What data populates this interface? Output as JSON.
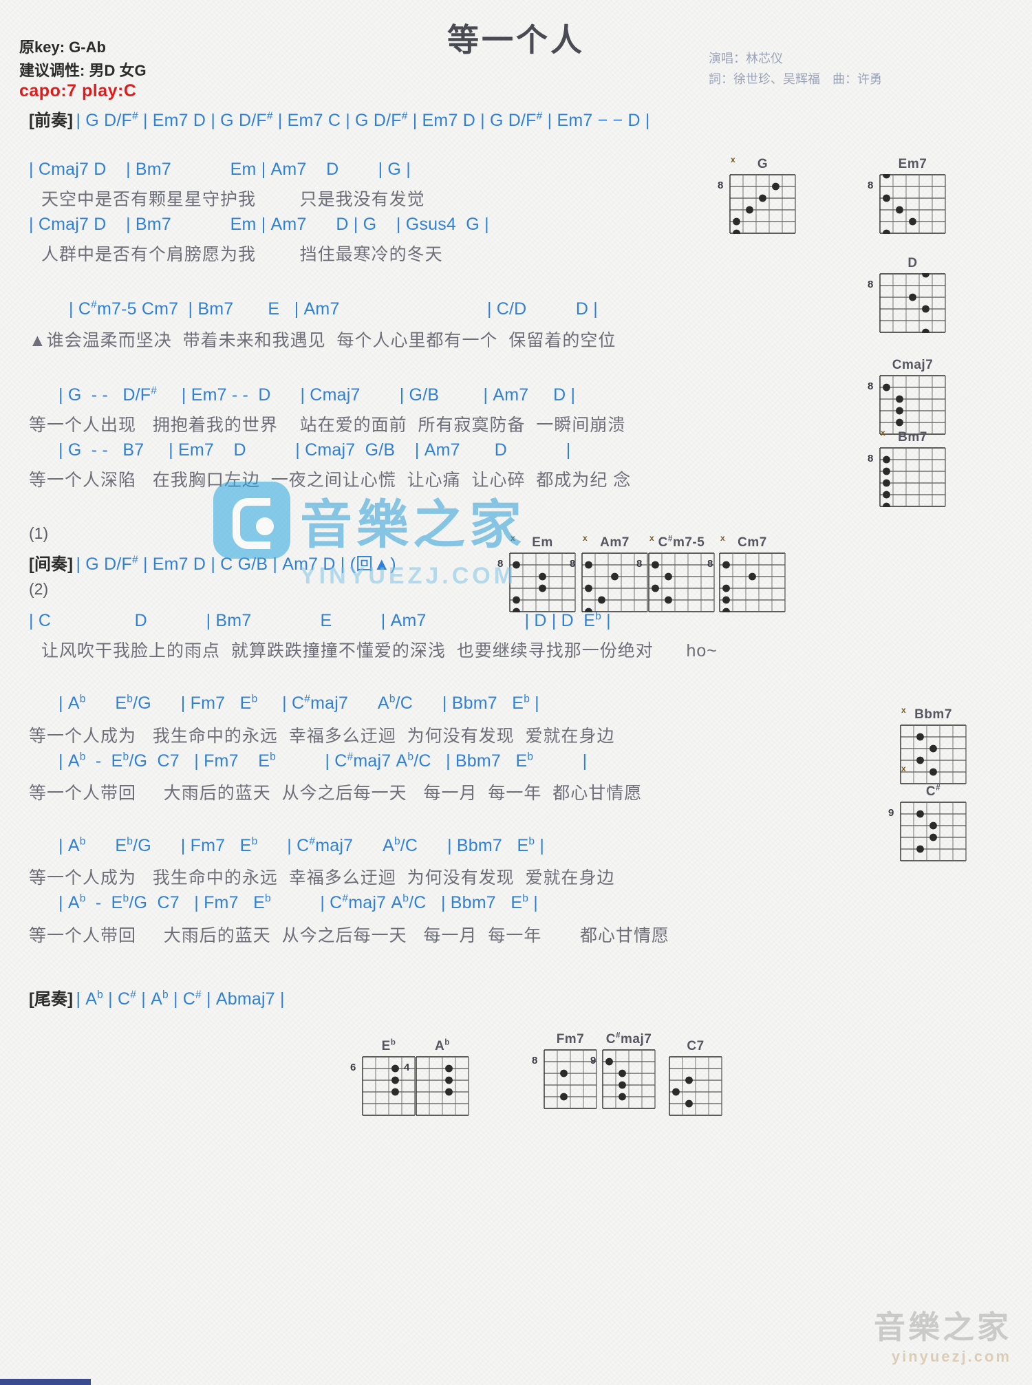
{
  "header": {
    "orig_key_label": "原key: G-Ab",
    "suggested_key_label": "建议调性: 男D 女G",
    "title": "等一个人",
    "singer": "演唱：林芯仪",
    "writers": "詞：徐世珍、吴辉福　曲：许勇",
    "capo": "capo:7 play:C"
  },
  "colors": {
    "chord": "#2f80d8",
    "lyric": "#6e6e78",
    "capo": "#e01b1b",
    "bar": "#b87820",
    "title": "#4a4a52",
    "watermark_blue": "#2f9fd9"
  },
  "sections": {
    "intro_label": "[前奏]",
    "interlude_label": "[间奏]",
    "outro_label": "[尾奏]",
    "ending_one": "(1)",
    "ending_two": "(2)",
    "repeat_mark": "▲"
  },
  "lines": [
    {
      "id": "intro",
      "type": "chords",
      "label": "[前奏]",
      "text": "| G D/F# | Em7 D | G D/F# | Em7 C | G D/F# | Em7 D | G D/F# | Em7 − − D |"
    },
    {
      "id": "v1c1",
      "type": "chords",
      "text": "| Cmaj7 D    | Bm7            Em | Am7    D        | G |"
    },
    {
      "id": "v1l1",
      "type": "lyric",
      "text": "天空中是否有颗星星守护我        只是我没有发觉"
    },
    {
      "id": "v1c2",
      "type": "chords",
      "text": "| Cmaj7 D    | Bm7            Em | Am7      D | G    | Gsus4  G |"
    },
    {
      "id": "v1l2",
      "type": "lyric",
      "text": "人群中是否有个肩膀愿为我        挡住最寒冷的冬天"
    },
    {
      "id": "prec1",
      "type": "chords",
      "text": "| C#m7-5 Cm7  | Bm7       E   | Am7                              | C/D          D |"
    },
    {
      "id": "prel1",
      "type": "lyric",
      "text": "▲谁会温柔而坚决  带着未来和我遇见  每个人心里都有一个  保留着的空位"
    },
    {
      "id": "ch1c1",
      "type": "chords",
      "text": "| G  - -   D/F#     | Em7 - -  D      | Cmaj7        | G/B         | Am7     D |"
    },
    {
      "id": "ch1l1",
      "type": "lyric",
      "text": "等一个人出现   拥抱着我的世界    站在爱的面前  所有寂寞防备  一瞬间崩溃"
    },
    {
      "id": "ch1c2",
      "type": "chords",
      "text": "| G  - -   B7     | Em7    D          | Cmaj7  G/B    | Am7       D            |"
    },
    {
      "id": "ch1l2",
      "type": "lyric",
      "text": "等一个人深陷   在我胸口左边  一夜之间让心慌  让心痛  让心碎  都成为纪 念"
    },
    {
      "id": "inter",
      "type": "chords",
      "label": "[间奏]",
      "text": "| G D/F# | Em7 D | C G/B | Am7 D | (回▲)"
    },
    {
      "id": "v2c1",
      "type": "chords",
      "text": "| C                 D            | Bm7              E          | Am7                    | D | D  Eb |"
    },
    {
      "id": "v2l1",
      "type": "lyric",
      "text": "让风吹干我脸上的雨点  就算跌跌撞撞不懂爱的深浅  也要继续寻找那一份绝对      ho~"
    },
    {
      "id": "ch2c1",
      "type": "chords",
      "text": "| Ab      Eb/G      | Fm7   Eb     | C#maj7      Ab/C      | Bbm7   Eb |"
    },
    {
      "id": "ch2l1",
      "type": "lyric",
      "text": "等一个人成为   我生命中的永远  幸福多么迂迴  为何没有发现  爱就在身边"
    },
    {
      "id": "ch2c2",
      "type": "chords",
      "text": "| Ab  -  Eb/G  C7   | Fm7    Eb          | C#maj7 Ab/C   | Bbm7   Eb          |"
    },
    {
      "id": "ch2l2",
      "type": "lyric",
      "text": "等一个人带回     大雨后的蓝天  从今之后每一天   每一月  每一年  都心甘情愿"
    },
    {
      "id": "ch3c1",
      "type": "chords",
      "text": "| Ab      Eb/G      | Fm7   Eb      | C#maj7      Ab/C      | Bbm7   Eb |"
    },
    {
      "id": "ch3l1",
      "type": "lyric",
      "text": "等一个人成为   我生命中的永远  幸福多么迂迴  为何没有发现  爱就在身边"
    },
    {
      "id": "ch3c2",
      "type": "chords",
      "text": "| Ab  -  Eb/G  C7   | Fm7   Eb          | C#maj7 Ab/C   | Bbm7   Eb |"
    },
    {
      "id": "ch3l2",
      "type": "lyric",
      "text": "等一个人带回     大雨后的蓝天  从今之后每一天   每一月  每一年       都心甘情愿"
    },
    {
      "id": "outro",
      "type": "chords",
      "label": "[尾奏]",
      "text": "| Ab | C# | Ab | C# | Abmaj7 |"
    }
  ],
  "chord_diagrams": [
    {
      "name": "G",
      "fret": "8",
      "strings": 6,
      "frets": 5,
      "mutes": [
        {
          "s": 0,
          "m": "x"
        }
      ],
      "dots": [
        {
          "s": 1,
          "f": 4
        },
        {
          "s": 2,
          "f": 3
        },
        {
          "s": 3,
          "f": 2
        },
        {
          "s": 4,
          "f": 1
        },
        {
          "s": 5,
          "f": 1
        }
      ]
    },
    {
      "name": "Em7",
      "fret": "8",
      "strings": 6,
      "frets": 5,
      "mutes": [],
      "dots": [
        {
          "s": 0,
          "f": 1
        },
        {
          "s": 2,
          "f": 1
        },
        {
          "s": 3,
          "f": 2
        },
        {
          "s": 4,
          "f": 3
        },
        {
          "s": 5,
          "f": 1
        }
      ]
    },
    {
      "name": "D",
      "fret": "8",
      "strings": 6,
      "frets": 5,
      "mutes": [],
      "dots": [
        {
          "s": 2,
          "f": 3
        },
        {
          "s": 3,
          "f": 4
        },
        {
          "s": 0,
          "f": 4
        },
        {
          "s": 5,
          "f": 4
        }
      ]
    },
    {
      "name": "Cmaj7",
      "fret": "8",
      "strings": 6,
      "frets": 5,
      "mutes": [],
      "dots": [
        {
          "s": 1,
          "f": 1
        },
        {
          "s": 2,
          "f": 2
        },
        {
          "s": 3,
          "f": 2
        },
        {
          "s": 4,
          "f": 2
        }
      ]
    },
    {
      "name": "Bm7",
      "fret": "8",
      "strings": 6,
      "frets": 5,
      "mutes": [
        {
          "s": 0,
          "m": "x"
        }
      ],
      "dots": [
        {
          "s": 1,
          "f": 1
        },
        {
          "s": 2,
          "f": 1
        },
        {
          "s": 3,
          "f": 1
        },
        {
          "s": 4,
          "f": 1
        },
        {
          "s": 5,
          "f": 1
        }
      ]
    },
    {
      "name": "Em",
      "fret": "8",
      "strings": 6,
      "frets": 5,
      "mutes": [
        {
          "s": 0,
          "m": "x"
        }
      ],
      "dots": [
        {
          "s": 1,
          "f": 1
        },
        {
          "s": 2,
          "f": 3
        },
        {
          "s": 3,
          "f": 3
        },
        {
          "s": 4,
          "f": 1
        },
        {
          "s": 5,
          "f": 1
        }
      ]
    },
    {
      "name": "Am7",
      "fret": "8",
      "strings": 6,
      "frets": 5,
      "mutes": [
        {
          "s": 0,
          "m": "x"
        }
      ],
      "dots": [
        {
          "s": 1,
          "f": 1
        },
        {
          "s": 2,
          "f": 3
        },
        {
          "s": 3,
          "f": 1
        },
        {
          "s": 4,
          "f": 2
        },
        {
          "s": 5,
          "f": 1
        }
      ]
    },
    {
      "name": "C#m7-5",
      "fret": "8",
      "strings": 6,
      "frets": 5,
      "mutes": [
        {
          "s": 0,
          "m": "x"
        }
      ],
      "dots": [
        {
          "s": 1,
          "f": 1
        },
        {
          "s": 2,
          "f": 2
        },
        {
          "s": 3,
          "f": 1
        },
        {
          "s": 4,
          "f": 2
        }
      ]
    },
    {
      "name": "Cm7",
      "fret": "8",
      "strings": 6,
      "frets": 5,
      "mutes": [
        {
          "s": 0,
          "m": "x"
        }
      ],
      "dots": [
        {
          "s": 1,
          "f": 1
        },
        {
          "s": 2,
          "f": 3
        },
        {
          "s": 3,
          "f": 1
        },
        {
          "s": 4,
          "f": 1
        },
        {
          "s": 5,
          "f": 1
        }
      ]
    },
    {
      "name": "Bbm7",
      "fret": "",
      "strings": 6,
      "frets": 5,
      "mutes": [
        {
          "s": 0,
          "m": "x"
        },
        {
          "s": 5,
          "m": "x"
        }
      ],
      "dots": [
        {
          "s": 1,
          "f": 2
        },
        {
          "s": 2,
          "f": 3
        },
        {
          "s": 3,
          "f": 2
        },
        {
          "s": 4,
          "f": 3
        }
      ]
    },
    {
      "name": "C#",
      "fret": "9",
      "strings": 6,
      "frets": 5,
      "mutes": [],
      "dots": [
        {
          "s": 1,
          "f": 2
        },
        {
          "s": 2,
          "f": 3
        },
        {
          "s": 3,
          "f": 3
        },
        {
          "s": 4,
          "f": 2
        }
      ]
    },
    {
      "name": "Eb",
      "fret": "6",
      "strings": 6,
      "frets": 4,
      "mutes": [],
      "dots": [
        {
          "s": 1,
          "f": 3
        },
        {
          "s": 2,
          "f": 3
        },
        {
          "s": 3,
          "f": 3
        }
      ]
    },
    {
      "name": "Ab",
      "fret": "4",
      "strings": 6,
      "frets": 4,
      "mutes": [],
      "dots": [
        {
          "s": 1,
          "f": 3
        },
        {
          "s": 2,
          "f": 3
        },
        {
          "s": 3,
          "f": 3
        }
      ]
    },
    {
      "name": "Fm7",
      "fret": "8",
      "strings": 6,
      "frets": 4,
      "mutes": [],
      "dots": [
        {
          "s": 2,
          "f": 2
        },
        {
          "s": 4,
          "f": 2
        }
      ]
    },
    {
      "name": "C#maj7",
      "fret": "9",
      "strings": 6,
      "frets": 4,
      "mutes": [],
      "dots": [
        {
          "s": 1,
          "f": 1
        },
        {
          "s": 2,
          "f": 2
        },
        {
          "s": 3,
          "f": 2
        },
        {
          "s": 4,
          "f": 2
        }
      ]
    },
    {
      "name": "C7",
      "fret": "",
      "strings": 6,
      "frets": 4,
      "mutes": [],
      "dots": [
        {
          "s": 2,
          "f": 2
        },
        {
          "s": 3,
          "f": 1
        },
        {
          "s": 4,
          "f": 2
        }
      ]
    }
  ],
  "watermark": {
    "text": "音樂之家",
    "url": "YINYUEZJ.COM",
    "bottom_text": "音樂之家",
    "bottom_url": "yinyuezj.com"
  }
}
